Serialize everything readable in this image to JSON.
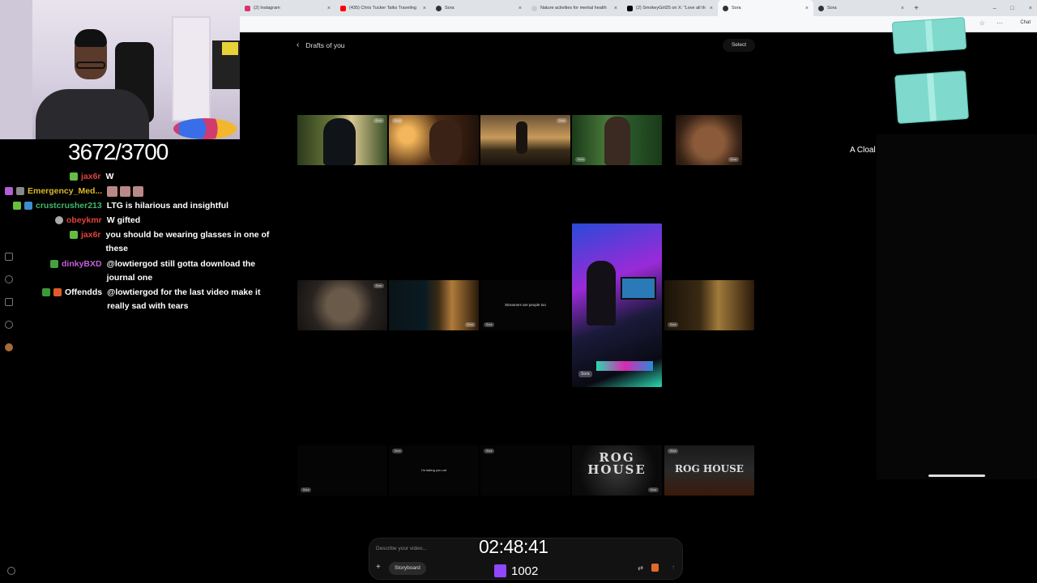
{
  "browser": {
    "tabs": [
      {
        "label": "(2) Instagram",
        "color": "#e1306c"
      },
      {
        "label": "(435) Chris Tucker Talks Traveling",
        "color": "#ff0000"
      },
      {
        "label": "Sora",
        "color": "#333333"
      },
      {
        "label": "Nature activities for mental health",
        "color": "#bbbbbb"
      },
      {
        "label": "(2) SmokeyGirl25 on X: \"Love all th",
        "color": "#000000"
      },
      {
        "label": "Sora",
        "color": "#333333",
        "active": true
      },
      {
        "label": "Sora",
        "color": "#333333"
      }
    ],
    "new_tab": "+",
    "chat_label": "Chat",
    "window_controls": [
      "–",
      "□",
      "×"
    ]
  },
  "stream": {
    "sub_counter": "3672/3700",
    "timer": "02:48:41",
    "viewer_count": "1002"
  },
  "chat": {
    "messages": [
      {
        "user": "jax6r",
        "user_color": "#e0443a",
        "text": "W",
        "badge_color": "#66bb44"
      },
      {
        "user": "Emergency_Med...",
        "user_color": "#d9b92a",
        "text": "",
        "emotes": 3,
        "badge_color": "#b35fd6"
      },
      {
        "user": "crustcrusher213",
        "user_color": "#41b86a",
        "text": "LTG is hilarious and insightful",
        "badge_color": "#6bbf3a"
      },
      {
        "user": "obeykmr",
        "user_color": "#e0443a",
        "text": "W gifted",
        "badge_color": "#aaaaaa"
      },
      {
        "user": "jax6r",
        "user_color": "#e0443a",
        "text": "you should be wearing glasses in one of these",
        "badge_color": "#66bb44"
      },
      {
        "user": "dinkyBXD",
        "user_color": "#c45fd8",
        "text": "@lowtiergod still gotta download the journal one",
        "badge_color": "#46a040"
      },
      {
        "user": "Offendds",
        "user_color": "#ffffff",
        "text": "@lowtiergod for the last video make it really sad with tears",
        "badge_color": "#3a9a3a"
      }
    ]
  },
  "sora": {
    "back_label": "Drafts of you",
    "select_label": "Select",
    "watermark": "Sora",
    "card_texts": {
      "streamers": "Streamers are people too",
      "small_caption": "I'm taking you out",
      "rog_house_1": "ROG HOUSE",
      "rog_house_2": "ROG HOUSE"
    },
    "prompt_placeholder": "Describe your video...",
    "storyboard_label": "Storyboard",
    "add_icon": "+"
  },
  "overlay": {
    "side_text": "A Cloal"
  }
}
